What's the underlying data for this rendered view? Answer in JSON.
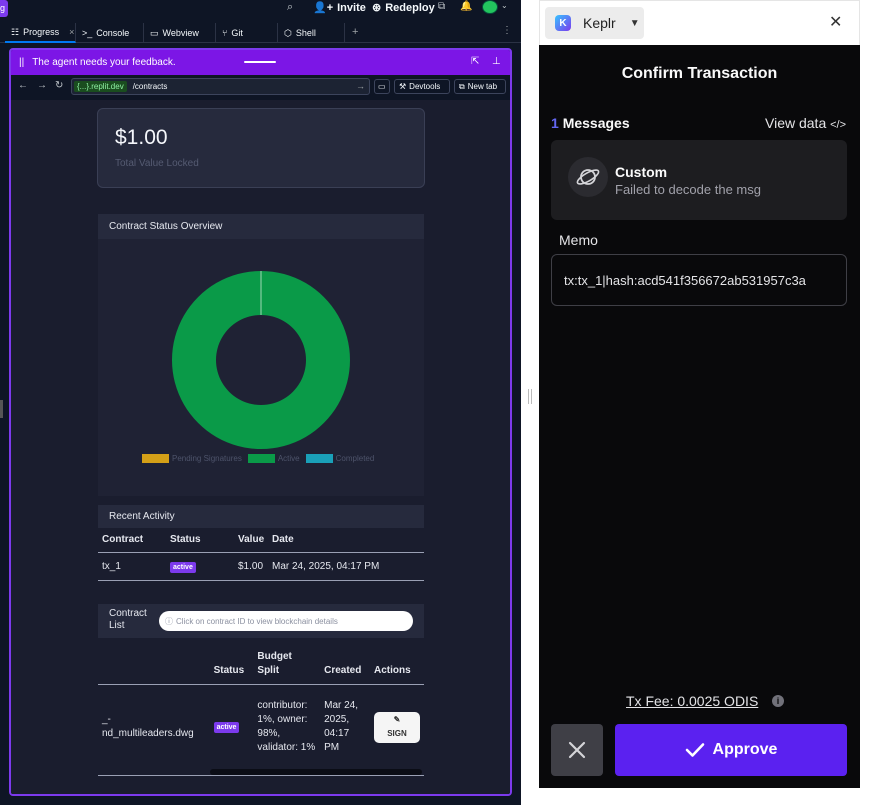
{
  "replit": {
    "topbar": {
      "invite_label": "Invite",
      "redeploy_label": "Redeploy"
    },
    "tabs": [
      {
        "label": "Progress"
      },
      {
        "label": "Console"
      },
      {
        "label": "Webview"
      },
      {
        "label": "Git"
      },
      {
        "label": "Shell"
      }
    ],
    "feedback_text": "The agent needs your feedback.",
    "url": {
      "host": "{...}.replit.dev",
      "path": "/contracts",
      "devtools_label": "Devtools",
      "newtab_label": "New tab"
    },
    "app": {
      "tvl_amount": "$1.00",
      "tvl_label": "Total Value Locked",
      "status_title": "Contract Status Overview",
      "chart_data": {
        "type": "pie",
        "categories": [
          "Pending Signatures",
          "Active",
          "Completed"
        ],
        "values": [
          0,
          1,
          0
        ],
        "colors": [
          "#d4a017",
          "#0a9a48",
          "#1aa0b8"
        ],
        "legend": "bottom"
      },
      "recent_title": "Recent Activity",
      "recent_headers": [
        "Contract",
        "Status",
        "Value",
        "Date"
      ],
      "recent_rows": [
        {
          "contract": "tx_1",
          "status": "active",
          "value": "$1.00",
          "date": "Mar 24, 2025, 04:17 PM"
        }
      ],
      "list_title": "Contract List",
      "list_hint": "Click on contract ID to view blockchain details",
      "list_headers": [
        "",
        "Status",
        "Budget Split",
        "Created",
        "Actions"
      ],
      "list_rows": [
        {
          "file": "_-\nnd_multileaders.dwg",
          "status": "active",
          "split": "contributor: 1%, owner: 98%, validator: 1%",
          "created": "Mar 24, 2025, 04:17 PM",
          "action": "SIGN"
        }
      ]
    }
  },
  "keplr": {
    "app_name": "Keplr",
    "title": "Confirm Transaction",
    "messages_count": "1",
    "messages_label": "Messages",
    "view_data_label": "View data",
    "message_title": "Custom",
    "message_subtitle": "Failed to decode the msg",
    "memo_label": "Memo",
    "memo_value": "tx:tx_1|hash:acd541f356672ab531957c3a",
    "fee_label": "Tx Fee: 0.0025 ODIS",
    "approve_label": "Approve"
  }
}
